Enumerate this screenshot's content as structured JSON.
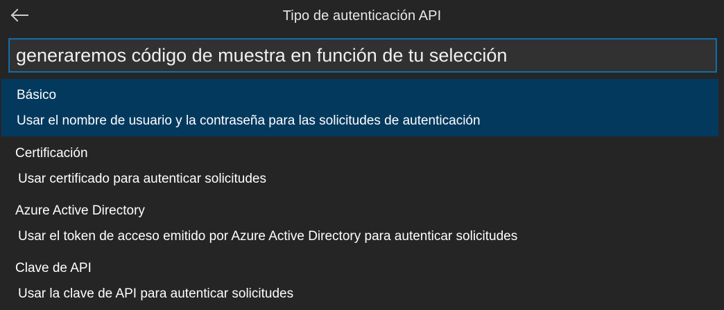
{
  "title": "Tipo de autenticación API",
  "search": {
    "placeholder": "generaremos código de muestra en función de tu selección"
  },
  "items": [
    {
      "label": "Básico",
      "detail": "Usar el nombre de usuario y la contraseña para las solicitudes de autenticación",
      "selected": true
    },
    {
      "label": "Certificación",
      "detail": "Usar certificado para autenticar solicitudes",
      "selected": false
    },
    {
      "label": "Azure Active Directory",
      "detail": "Usar el token de acceso emitido por Azure Active Directory para autenticar solicitudes",
      "selected": false
    },
    {
      "label": "Clave de API",
      "detail": "Usar la clave de API para autenticar solicitudes",
      "selected": false
    }
  ],
  "icons": {
    "back": "arrow-left-icon"
  },
  "colors": {
    "background": "#252526",
    "selection": "#04395e",
    "input_border": "#0e639c",
    "text": "#ffffff"
  }
}
